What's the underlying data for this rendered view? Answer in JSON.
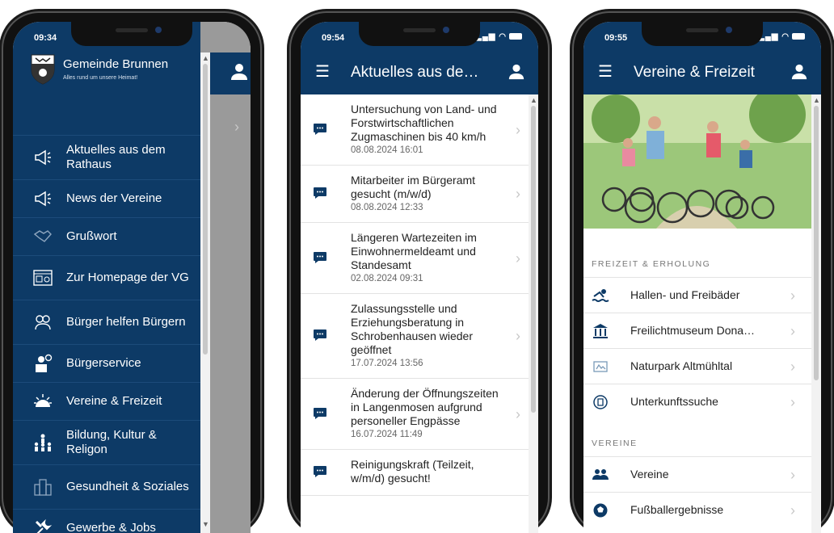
{
  "phone1": {
    "time": "09:34",
    "gemeinde": {
      "name": "Gemeinde Brunnen",
      "tagline": "Alles rund um unsere Heimat!"
    },
    "menu": [
      {
        "label": "Aktuelles aus dem Rathaus",
        "icon": "megaphone-icon"
      },
      {
        "label": "News der Vereine",
        "icon": "megaphone-icon"
      },
      {
        "label": "Grußwort",
        "icon": "handshake-icon"
      },
      {
        "label": "Zur Homepage der VG",
        "icon": "website-icon"
      },
      {
        "label": "Bürger helfen Bürgern",
        "icon": "helping-hands-icon"
      },
      {
        "label": "Bürgerservice",
        "icon": "service-icon"
      },
      {
        "label": "Vereine & Freizeit",
        "icon": "sun-icon"
      },
      {
        "label": "Bildung, Kultur & Religon",
        "icon": "people-icon"
      },
      {
        "label": "Gesundheit & Soziales",
        "icon": "building-icon"
      },
      {
        "label": "Gewerbe & Jobs",
        "icon": "tools-icon"
      }
    ]
  },
  "phone2": {
    "time": "09:54",
    "title": "Aktuelles aus de…",
    "news": [
      {
        "title": "Untersuchung von Land- und Forstwirtschaftlichen Zugmaschinen bis 40 km/h",
        "date": "08.08.2024 16:01"
      },
      {
        "title": "Mitarbeiter im Bürgeramt gesucht (m/w/d)",
        "date": "08.08.2024 12:33"
      },
      {
        "title": "Längeren Wartezeiten im Einwohnermeldeamt und Standesamt",
        "date": "02.08.2024 09:31"
      },
      {
        "title": "Zulassungsstelle und Erziehungsberatung in Schrobenhausen wieder geöffnet",
        "date": "17.07.2024 13:56"
      },
      {
        "title": "Änderung der Öffnungszeiten in Langenmosen aufgrund personeller Engpässe",
        "date": "16.07.2024 11:49"
      },
      {
        "title": "Reinigungskraft (Teilzeit, w/m/d) gesucht!",
        "date": ""
      }
    ]
  },
  "phone3": {
    "time": "09:55",
    "title": "Vereine & Freizeit",
    "section1": "FREIZEIT & ERHOLUNG",
    "freizeit": [
      {
        "label": "Hallen- und Freibäder",
        "icon": "swimmer-icon"
      },
      {
        "label": "Freilichtmuseum Dona…",
        "icon": "museum-icon"
      },
      {
        "label": "Naturpark Altmühltal",
        "icon": "park-icon"
      },
      {
        "label": "Unterkunftssuche",
        "icon": "lodging-icon"
      }
    ],
    "section2": "VEREINE",
    "vereine": [
      {
        "label": "Vereine",
        "icon": "group-icon"
      },
      {
        "label": "Fußballergebnisse",
        "icon": "football-icon"
      }
    ]
  }
}
